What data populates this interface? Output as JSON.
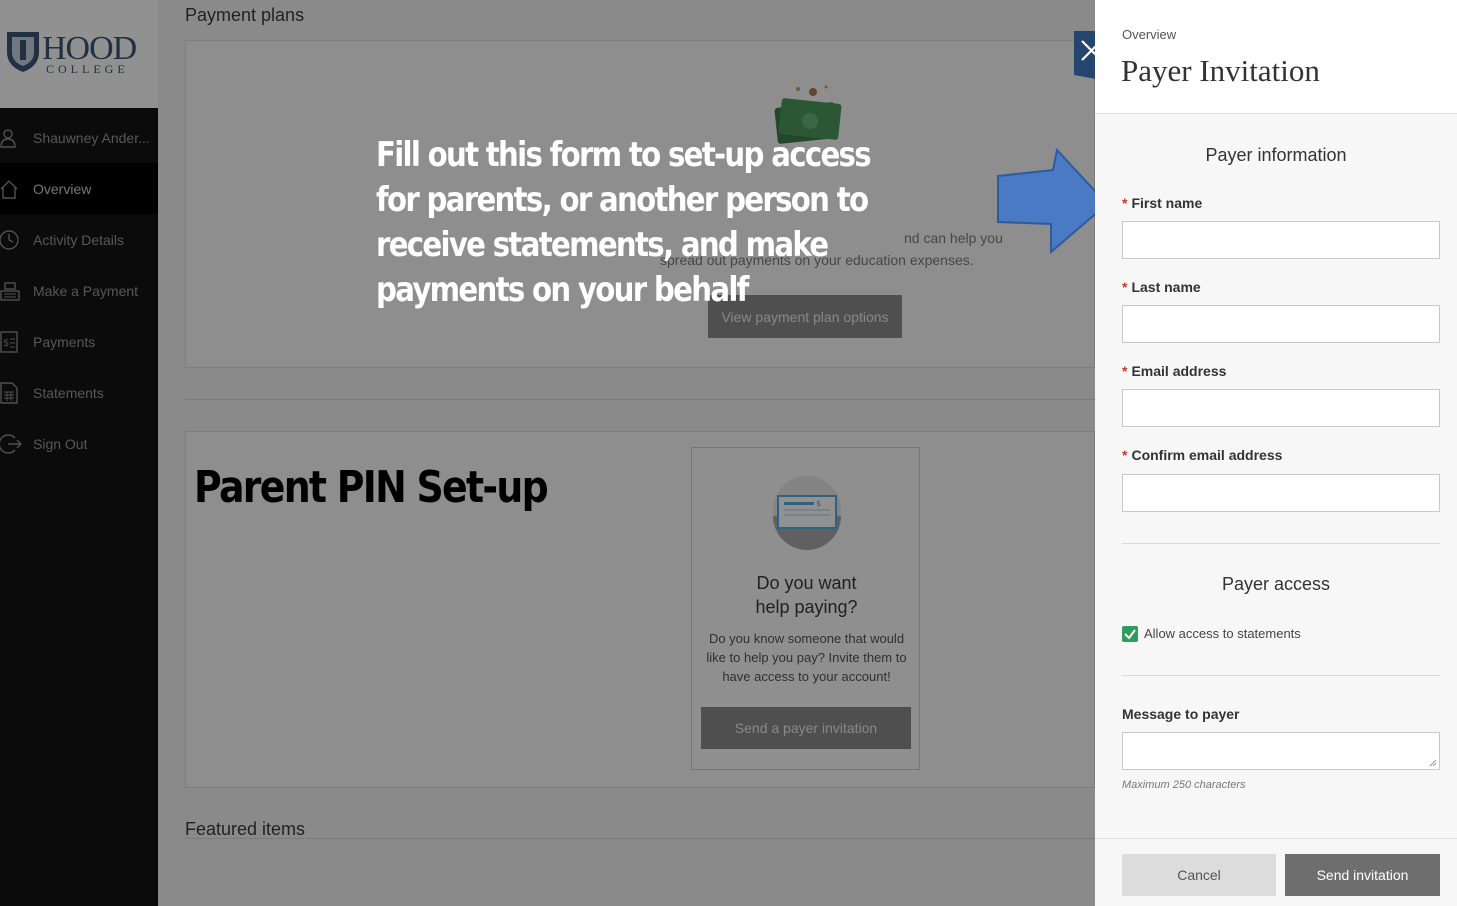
{
  "logo": {
    "name": "HOOD",
    "sub": "COLLEGE"
  },
  "sidebar": {
    "items": [
      {
        "label": "Shauwney Ander...",
        "icon": "user-icon"
      },
      {
        "label": "Overview",
        "icon": "home-icon"
      },
      {
        "label": "Activity Details",
        "icon": "clock-icon"
      },
      {
        "label": "Make a Payment",
        "icon": "cash-register-icon"
      },
      {
        "label": "Payments",
        "icon": "receipt-icon"
      },
      {
        "label": "Statements",
        "icon": "statement-icon"
      },
      {
        "label": "Sign Out",
        "icon": "sign-out-icon"
      }
    ]
  },
  "main": {
    "payment_plans_title": "Payment plans",
    "plans_text_line1": "nd can help you",
    "plans_text_line2": "spread out payments on your education expenses.",
    "plans_button": "View payment plan options",
    "help_title_line1": "Do you want",
    "help_title_line2": "help paying?",
    "help_body": "Do you know someone that would like to help you pay? Invite them to have access to your account!",
    "help_button": "Send a payer invitation",
    "featured_title": "Featured items"
  },
  "annotations": {
    "instruction": "Fill out this form to set-up access for parents, or another person to receive statements, and make payments on your behalf",
    "parent_pin": "Parent PIN Set-up"
  },
  "panel": {
    "breadcrumb": "Overview",
    "title": "Payer Invitation",
    "payer_info_heading": "Payer information",
    "required_mark": "*",
    "fields": {
      "first_name": "First name",
      "last_name": "Last name",
      "email": "Email address",
      "confirm_email": "Confirm email address"
    },
    "payer_access_heading": "Payer access",
    "allow_statements_label": "Allow access to statements",
    "message_label": "Message to payer",
    "message_hint": "Maximum 250 characters",
    "cancel_label": "Cancel",
    "send_label": "Send invitation"
  },
  "colors": {
    "accent_navy": "#24456e",
    "checkbox_green": "#2e9e5b",
    "arrow_blue": "#4a7ac4"
  }
}
